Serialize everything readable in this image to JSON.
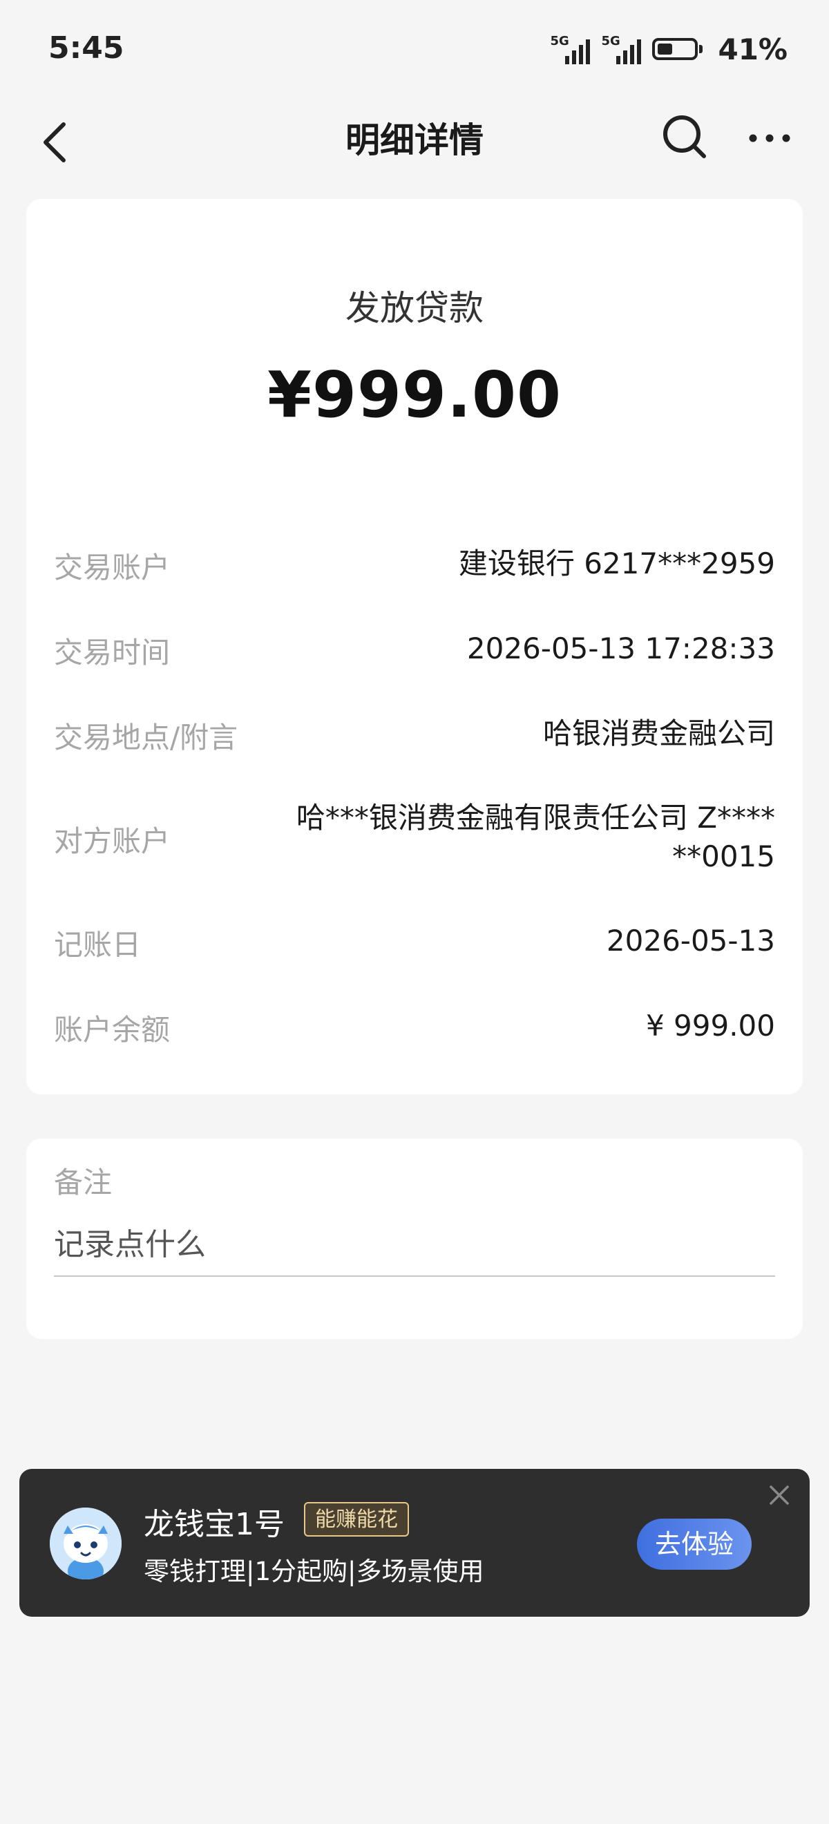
{
  "status_bar": {
    "time": "5:45",
    "network1": "5G",
    "network2": "5G",
    "battery_level": 0.41,
    "battery_text": "41%"
  },
  "nav": {
    "title": "明细详情",
    "icons": [
      "back-arrow-icon",
      "search-icon",
      "more-icon"
    ]
  },
  "transaction": {
    "type": "发放贷款",
    "amount": "¥999.00",
    "rows": [
      {
        "label": "交易账户",
        "value": "建设银行 6217***2959"
      },
      {
        "label": "交易时间",
        "value": "2026-05-13 17:28:33"
      },
      {
        "label": "交易地点/附言",
        "value": "哈银消费金融公司"
      },
      {
        "label": "对方账户",
        "value_line1": "哈***银消费金融有限责任公司 Z****",
        "value_line2": "**0015"
      },
      {
        "label": "记账日",
        "value": "2026-05-13"
      },
      {
        "label": "账户余额",
        "value": "¥ 999.00"
      }
    ]
  },
  "remark": {
    "title": "备注",
    "placeholder": "记录点什么"
  },
  "promo": {
    "title": "龙钱宝1号",
    "tag": "能赚能花",
    "subtitle": "零钱打理|1分起购|多场景使用",
    "button": "去体验",
    "close_icon": "close-icon"
  }
}
